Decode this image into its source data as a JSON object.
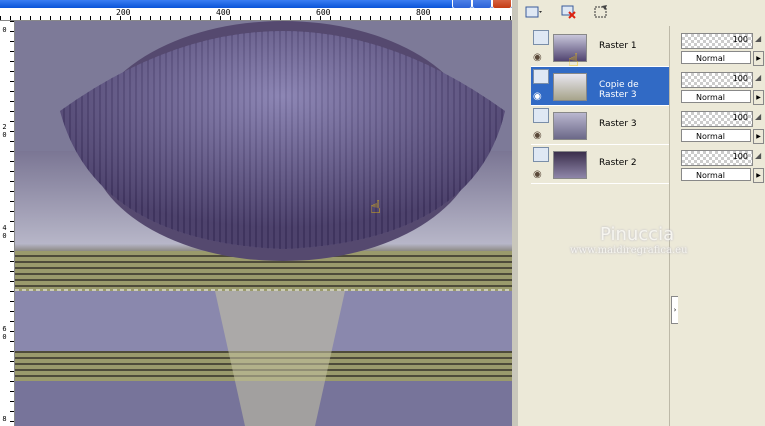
{
  "ruler": {
    "top_ticks": [
      "200",
      "400",
      "600",
      "800"
    ],
    "left_ticks": [
      "0",
      "2",
      "0",
      "4",
      "0",
      "6",
      "0",
      "8"
    ]
  },
  "layers": [
    {
      "name": "Raster 1",
      "selected": false
    },
    {
      "name": "Copie de Raster 3",
      "selected": true
    },
    {
      "name": "Raster 3",
      "selected": false
    },
    {
      "name": "Raster 2",
      "selected": false
    }
  ],
  "layer_props": [
    {
      "opacity": "100",
      "blend": "Normal"
    },
    {
      "opacity": "100",
      "blend": "Normal"
    },
    {
      "opacity": "100",
      "blend": "Normal"
    },
    {
      "opacity": "100",
      "blend": "Normal"
    }
  ],
  "watermark": {
    "name": "Pinuccia",
    "site": "www.maidiregrafica.eu"
  },
  "icons": {
    "new_layer": "new-layer-icon",
    "delete_layer": "delete-layer-icon",
    "mask": "mask-icon",
    "eye": "eye-icon",
    "pointer": "pointing-hand-icon"
  },
  "colors": {
    "selection": "#316ac5",
    "panel": "#ece9d8"
  }
}
